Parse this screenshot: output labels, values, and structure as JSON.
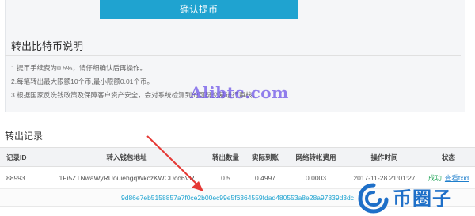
{
  "confirm_button": {
    "label": "确认提币"
  },
  "info": {
    "title": "转出比特币说明",
    "notes": [
      "1.提币手续费为0.5%，请仔细确认后再操作。",
      "2.每笔转出最大限额10个币,最小限额0.01个币。",
      "3.根据国家反洗钱政策及保障客户资产安全，会对系统检测到的可疑交易进行审核。"
    ]
  },
  "watermark": {
    "text": "Alibtc.com"
  },
  "records": {
    "title": "转出记录",
    "headers": {
      "id": "记录ID",
      "address": "转入钱包地址",
      "amount": "转出数量",
      "received": "实际到账",
      "fee": "网络转帐费用",
      "time": "操作时间",
      "status": "状态"
    },
    "rows": [
      {
        "id": "88993",
        "address": "1Fi5ZTNwaWyRUouiehgqWkczKWCDco6VR",
        "amount": "0.5",
        "received": "0.4997",
        "fee": "0.0003",
        "time": "2017-11-28 21:01:27",
        "status": "成功",
        "detail_link": "查看txid",
        "txid": "9d86e7eb5158857a7f0ce2b00ec99e5f6364559fdad480553a8e28a97839d3dc"
      }
    ]
  },
  "brand": {
    "text": "币圈子",
    "color": "#1e6fc8"
  },
  "colors": {
    "accent": "#1fa3d0",
    "success": "#26a65b",
    "annotation_arrow": "#e53935",
    "watermark": "#6a4ee8"
  }
}
